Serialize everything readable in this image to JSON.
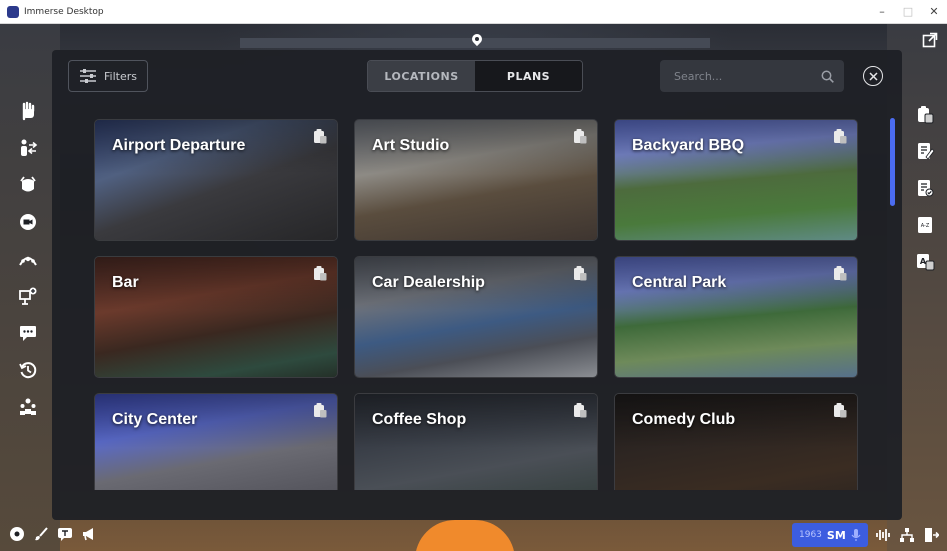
{
  "window": {
    "title": "Immerse Desktop",
    "minimize": "–",
    "maximize": "□",
    "close": "✕"
  },
  "panel": {
    "filters_label": "Filters",
    "tabs": [
      {
        "label": "LOCATIONS",
        "active": true
      },
      {
        "label": "PLANS",
        "active": false
      }
    ],
    "search_placeholder": "Search...",
    "locations": [
      {
        "name": "Airport Departure"
      },
      {
        "name": "Art Studio"
      },
      {
        "name": "Backyard BBQ"
      },
      {
        "name": "Bar"
      },
      {
        "name": "Car Dealership"
      },
      {
        "name": "Central Park"
      },
      {
        "name": "City Center"
      },
      {
        "name": "Coffee Shop"
      },
      {
        "name": "Comedy Club"
      }
    ]
  },
  "left_sidebar": [
    "raise-hand-icon",
    "switch-user-icon",
    "emote-icon",
    "camera-icon",
    "gesture-icon",
    "presentation-icon",
    "chat-icon",
    "history-icon",
    "group-icon"
  ],
  "right_sidebar": [
    "clipboard-icon",
    "notes-edit-icon",
    "checklist-icon",
    "vocabulary-icon",
    "translate-icon"
  ],
  "right_sidebar_text": {
    "vocab": "A-Z",
    "translate": "A"
  },
  "bottom_bar": {
    "count": "1963",
    "initials": "SM"
  },
  "colors": {
    "accent": "#4b6cf0",
    "panel_bg": "#1e2025"
  }
}
